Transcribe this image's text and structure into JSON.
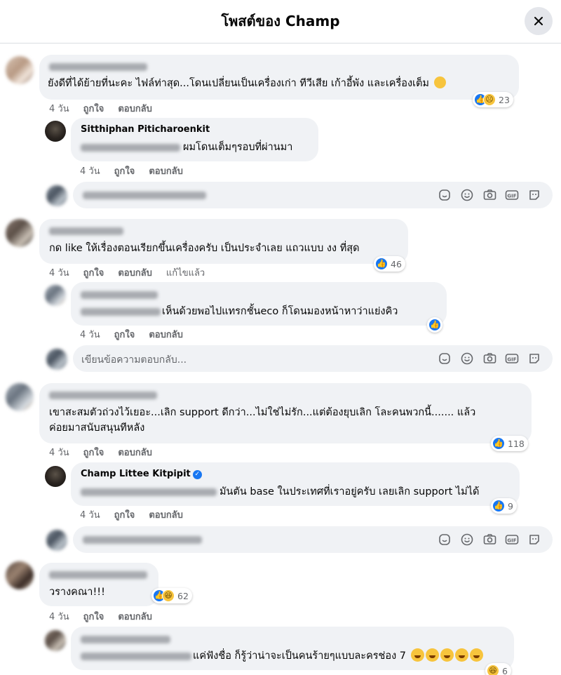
{
  "header": {
    "title": "โพสต์ของ Champ"
  },
  "actions": {
    "time": "4 วัน",
    "like": "ถูกใจ",
    "reply": "ตอบกลับ",
    "edited": "แก้ไขแล้ว"
  },
  "reply_placeholder": "เขียนข้อความตอบกลับ...",
  "reply_icons": [
    "sticker-icon",
    "emoji-icon",
    "camera-icon",
    "gif-icon",
    "avatar-sticker-icon"
  ],
  "comments": [
    {
      "text": "ยังดีที่ได้ย้ายที่นะคะ ไฟล์ท่าสุด...โดนเปลี่ยนเป็นเครื่องเก่า ทีวีเสีย เก้าอี้พัง และเครื่องเต็ม",
      "reaction_count": "23"
    },
    {
      "author": "Sitthiphan Piticharoenkit",
      "text": "ผมโดนเต็มๆรอบที่ผ่านมา"
    },
    {
      "text": "กด like ให้เรื่องตอนเรียกขึ้นเครื่องครับ เป็นประจำเลย แถวแบบ งง ที่สุด",
      "reaction_count": "46"
    },
    {
      "text": "เห็นด้วยพอไปแทรกชั้นeco ก็โดนมองหน้าหาว่าแย่งคิว"
    },
    {
      "text_line1": "เขาสะสมตัวถ่วงไว้เยอะ...เลิก support ดีกว่า...ไม่ใช่ไม่รัก...แต่ต้องยุบเลิก โละคนพวกนี้....... แล้ว",
      "text_line2": "ค่อยมาสนับสนุนทีหลัง",
      "reaction_count": "118"
    },
    {
      "author": "Champ Littee Kitpipit",
      "text": "มันตัน base ในประเทศที่เราอยู่ครับ เลยเลิก support ไม่ได้",
      "reaction_count": "9"
    },
    {
      "text": "วรางคณา!!!",
      "reaction_count": "62"
    },
    {
      "text": "แค่ฟังชื่อ ก็รู้ว่าน่าจะเป็นคนร้ายๆแบบละครช่อง 7",
      "reaction_count": "6"
    }
  ]
}
